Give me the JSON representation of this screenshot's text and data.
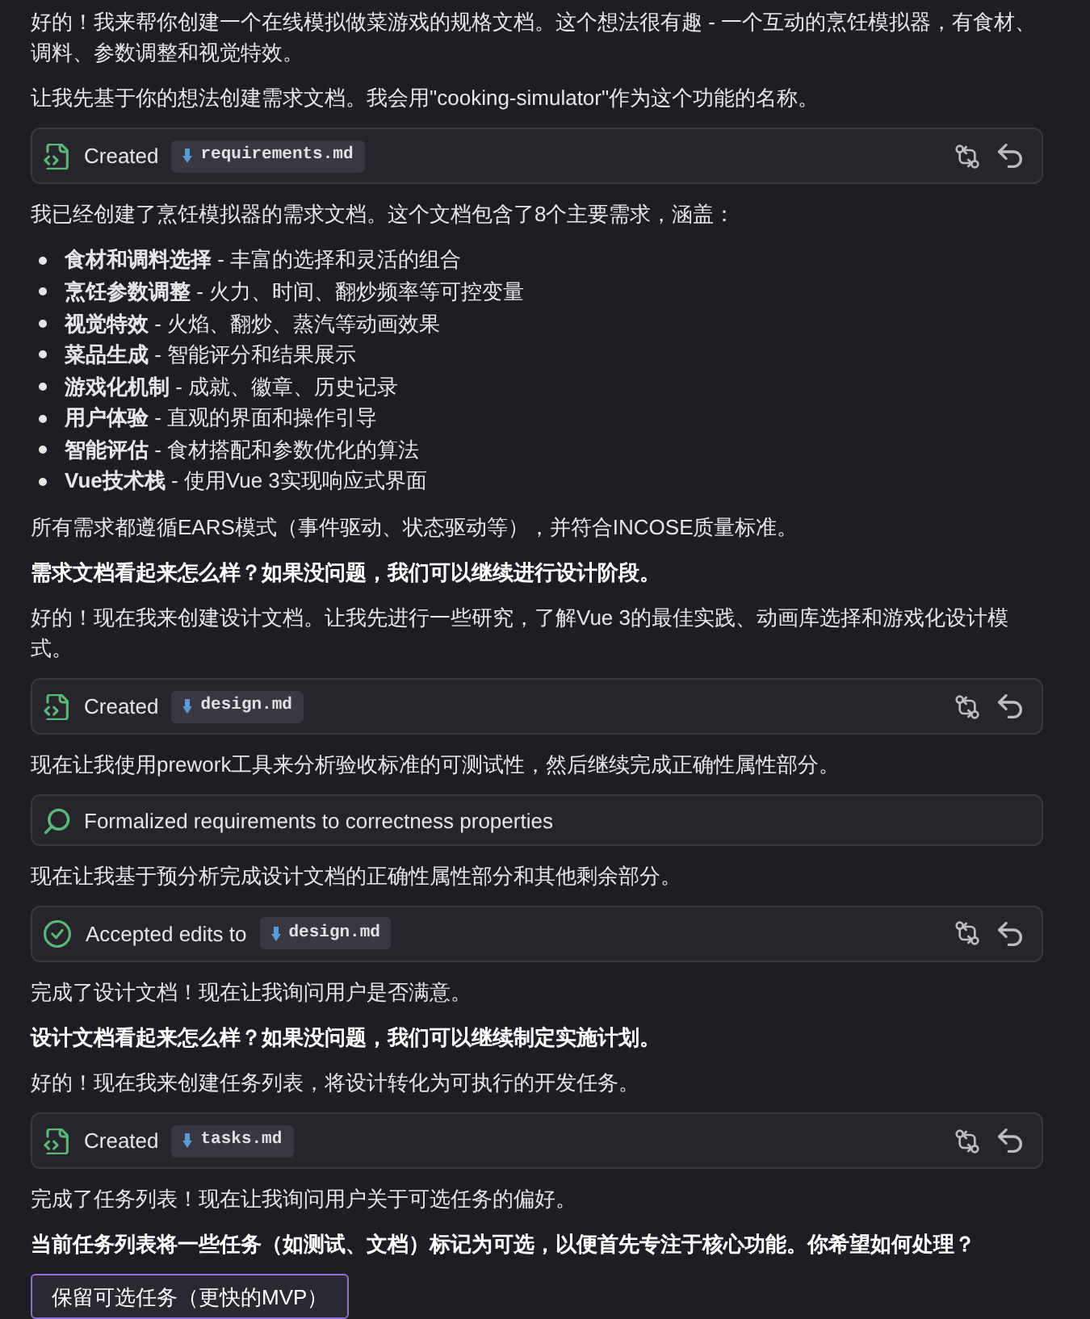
{
  "messages": [
    {
      "kind": "paragraph",
      "text": "好的！我来帮你创建一个在线模拟做菜游戏的规格文档。这个想法很有趣 - 一个互动的烹饪模拟器，有食材、调料、参数调整和视觉特效。"
    },
    {
      "kind": "paragraph",
      "text": "让我先基于你的想法创建需求文档。我会用\"cooking-simulator\"作为这个功能的名称。"
    },
    {
      "kind": "file_created",
      "action": "Created",
      "file": "requirements.md"
    },
    {
      "kind": "paragraph",
      "text": "我已经创建了烹饪模拟器的需求文档。这个文档包含了8个主要需求，涵盖："
    },
    {
      "kind": "bullet_list",
      "items": [
        "**食材和调料选择** - 丰富的选择和灵活的组合",
        "**烹饪参数调整** - 火力、时间、翻炒频率等可控变量",
        "**视觉特效** - 火焰、翻炒、蒸汽等动画效果",
        "**菜品生成** - 智能评分和结果展示",
        "**游戏化机制** - 成就、徽章、历史记录",
        "**用户体验** - 直观的界面和操作引导",
        "**智能评估** - 食材搭配和参数优化的算法",
        "**Vue技术栈** - 使用Vue 3实现响应式界面"
      ]
    },
    {
      "kind": "paragraph",
      "text": "所有需求都遵循EARS模式（事件驱动、状态驱动等），并符合INCOSE质量标准。"
    },
    {
      "kind": "bold_paragraph",
      "text": "需求文档看起来怎么样？如果没问题，我们可以继续进行设计阶段。"
    },
    {
      "kind": "paragraph",
      "text": "好的！现在我来创建设计文档。让我先进行一些研究，了解Vue 3的最佳实践、动画库选择和游戏化设计模式。"
    },
    {
      "kind": "file_created",
      "action": "Created",
      "file": "design.md"
    },
    {
      "kind": "paragraph",
      "text": "现在让我使用prework工具来分析验收标准的可测试性，然后继续完成正确性属性部分。"
    },
    {
      "kind": "tool_step",
      "text": "Formalized requirements to correctness properties"
    },
    {
      "kind": "paragraph",
      "text": "现在让我基于预分析完成设计文档的正确性属性部分和其他剩余部分。"
    },
    {
      "kind": "file_accepted",
      "action": "Accepted edits to",
      "file": "design.md"
    },
    {
      "kind": "paragraph",
      "text": "完成了设计文档！现在让我询问用户是否满意。"
    },
    {
      "kind": "bold_paragraph",
      "text": "设计文档看起来怎么样？如果没问题，我们可以继续制定实施计划。"
    },
    {
      "kind": "paragraph",
      "text": "好的！现在我来创建任务列表，将设计转化为可执行的开发任务。"
    },
    {
      "kind": "file_created",
      "action": "Created",
      "file": "tasks.md"
    },
    {
      "kind": "paragraph",
      "text": "完成了任务列表！现在让我询问用户关于可选任务的偏好。"
    },
    {
      "kind": "bold_paragraph",
      "text": "当前任务列表将一些任务（如测试、文档）标记为可选，以便首先专注于核心功能。你希望如何处理？"
    },
    {
      "kind": "option_button",
      "label": "保留可选任务（更快的MVP）"
    }
  ]
}
